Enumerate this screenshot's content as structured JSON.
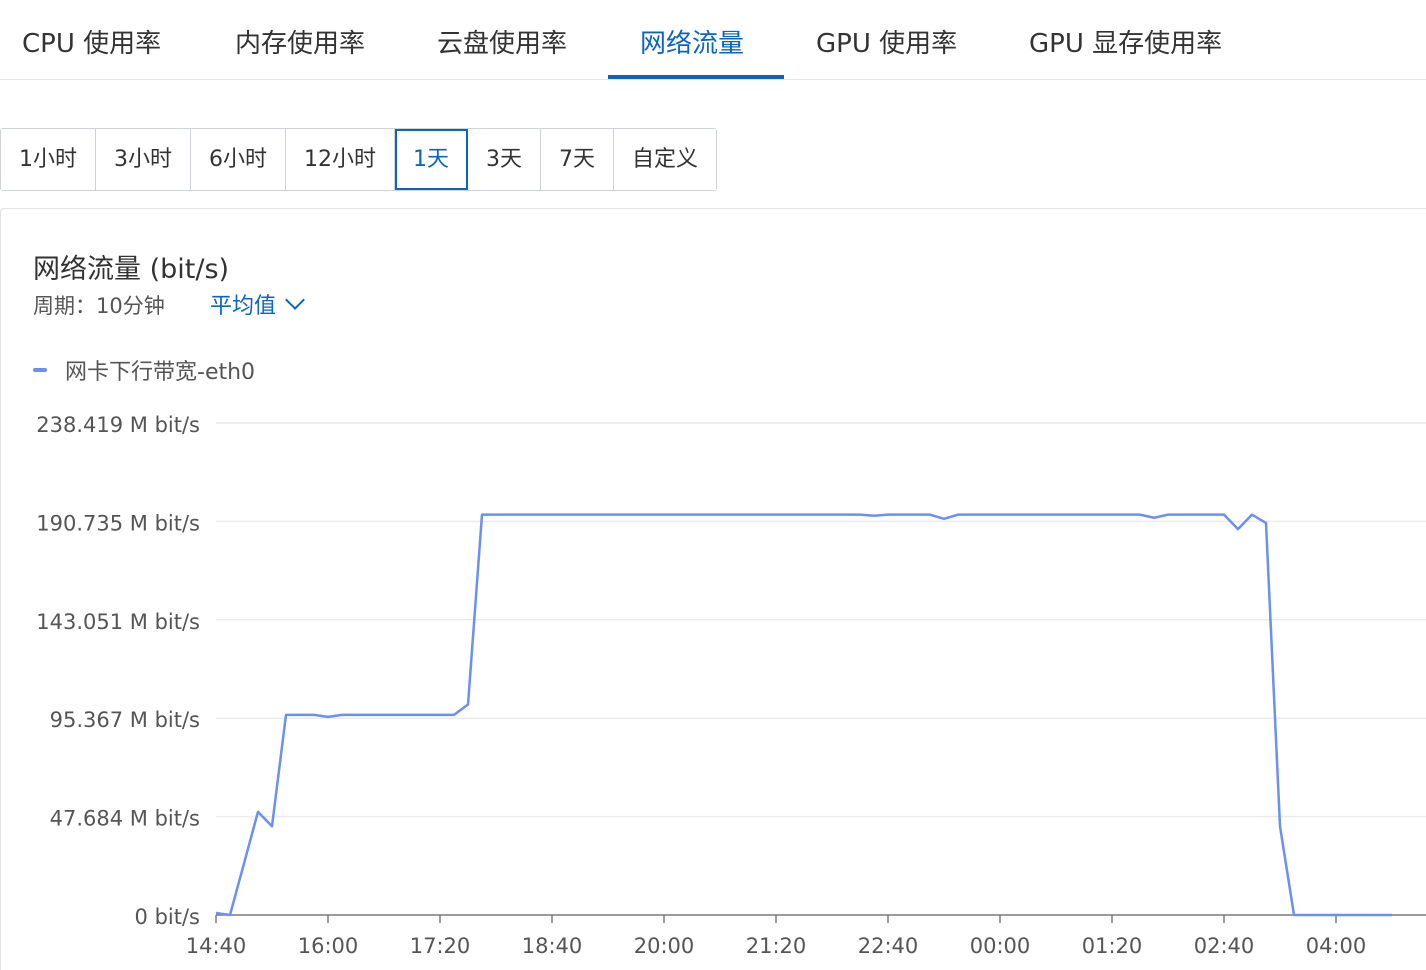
{
  "tabs": [
    {
      "label": "CPU 使用率",
      "active": false
    },
    {
      "label": "内存使用率",
      "active": false
    },
    {
      "label": "云盘使用率",
      "active": false
    },
    {
      "label": "网络流量",
      "active": true
    },
    {
      "label": "GPU 使用率",
      "active": false
    },
    {
      "label": "GPU 显存使用率",
      "active": false
    }
  ],
  "time_range": {
    "options": [
      "1小时",
      "3小时",
      "6小时",
      "12小时",
      "1天",
      "3天",
      "7天",
      "自定义"
    ],
    "selected": "1天"
  },
  "panel": {
    "title": "网络流量 (bit/s)",
    "period": "周期：10分钟",
    "aggregation": "平均值"
  },
  "colors": {
    "accent": "#0b64c0",
    "series": "#6b8ff2",
    "grid": "#ececec",
    "axis": "#555555"
  },
  "chart_data": {
    "type": "line",
    "series": [
      {
        "name": "网卡下行带宽-eth0",
        "x": [
          "14:40",
          "14:50",
          "15:00",
          "15:10",
          "15:20",
          "15:30",
          "15:40",
          "15:50",
          "16:00",
          "16:10",
          "16:20",
          "16:30",
          "16:40",
          "16:50",
          "17:00",
          "17:10",
          "17:20",
          "17:30",
          "17:40",
          "17:50",
          "18:00",
          "18:10",
          "18:20",
          "18:30",
          "18:40",
          "18:50",
          "19:00",
          "19:10",
          "19:20",
          "19:30",
          "19:40",
          "19:50",
          "20:00",
          "20:10",
          "20:20",
          "20:30",
          "20:40",
          "20:50",
          "21:00",
          "21:10",
          "21:20",
          "21:30",
          "21:40",
          "21:50",
          "22:00",
          "22:10",
          "22:20",
          "22:30",
          "22:40",
          "22:50",
          "23:00",
          "23:10",
          "23:20",
          "23:30",
          "23:40",
          "23:50",
          "00:00",
          "00:10",
          "00:20",
          "00:30",
          "00:40",
          "00:50",
          "01:00",
          "01:10",
          "01:20",
          "01:30",
          "01:40",
          "01:50",
          "02:00",
          "02:10",
          "02:20",
          "02:30",
          "02:40",
          "02:50",
          "03:00",
          "03:10",
          "03:20",
          "03:30",
          "03:40",
          "03:50",
          "04:00",
          "04:10",
          "04:20",
          "04:30",
          "04:40"
        ],
        "values": [
          1,
          0,
          25,
          50,
          43,
          97,
          97,
          97,
          96,
          97,
          97,
          97,
          97,
          97,
          97,
          97,
          97,
          97,
          102,
          194,
          194,
          194,
          194,
          194,
          194,
          194,
          194,
          194,
          194,
          194,
          194,
          194,
          194,
          194,
          194,
          194,
          194,
          194,
          194,
          194,
          194,
          194,
          194,
          194,
          194,
          194,
          194,
          193.5,
          194,
          194,
          194,
          194,
          192,
          194,
          194,
          194,
          194,
          194,
          194,
          194,
          194,
          194,
          194,
          194,
          194,
          194,
          194,
          192.5,
          194,
          194,
          194,
          194,
          194,
          187,
          194,
          190,
          43,
          0,
          0,
          0,
          0,
          0,
          0,
          0,
          0
        ]
      }
    ],
    "ylabel": "",
    "xlabel": "",
    "y_ticks": [
      "0  bit/s",
      "47.684 M bit/s",
      "95.367 M bit/s",
      "143.051 M bit/s",
      "190.735 M bit/s",
      "238.419 M bit/s"
    ],
    "y_tick_values": [
      0,
      47.684,
      95.367,
      143.051,
      190.735,
      238.419
    ],
    "x_ticks": [
      "14:40",
      "16:00",
      "17:20",
      "18:40",
      "20:00",
      "21:20",
      "22:40",
      "00:00",
      "01:20",
      "02:40",
      "04:00"
    ],
    "ylim": [
      0,
      238.419
    ],
    "grid": true,
    "legend": "top-left"
  }
}
